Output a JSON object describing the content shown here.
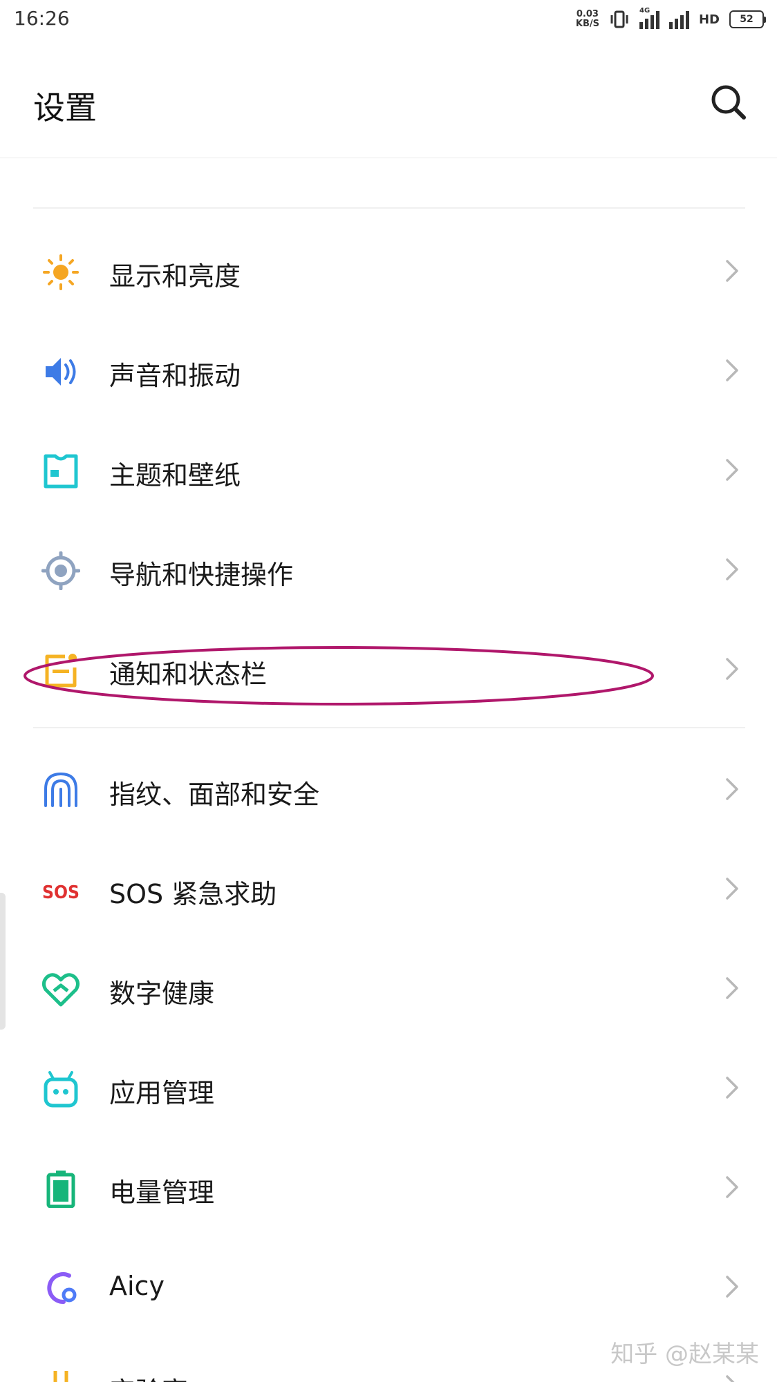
{
  "status_bar": {
    "time": "16:26",
    "net_speed_value": "0.03",
    "net_speed_unit": "KB/S",
    "network_tag": "4G",
    "hd_label": "HD",
    "battery_level": "52"
  },
  "header": {
    "title": "设置"
  },
  "settings_items": [
    {
      "label": "显示和亮度",
      "icon": "sun-icon",
      "color": "#F5A623"
    },
    {
      "label": "声音和振动",
      "icon": "speaker-icon",
      "color": "#3D7BE6"
    },
    {
      "label": "主题和壁纸",
      "icon": "shirt-icon",
      "color": "#1FC6D0"
    },
    {
      "label": "导航和快捷操作",
      "icon": "target-icon",
      "color": "#8FA3C0"
    },
    {
      "label": "通知和状态栏",
      "icon": "notification-icon",
      "color": "#F5B324"
    },
    {
      "label": "指纹、面部和安全",
      "icon": "fingerprint-icon",
      "color": "#3D7BE6"
    },
    {
      "label": "SOS 紧急求助",
      "icon": "sos-icon",
      "color": "#E03131"
    },
    {
      "label": "数字健康",
      "icon": "heart-icon",
      "color": "#1DBF8A"
    },
    {
      "label": "应用管理",
      "icon": "android-icon",
      "color": "#1FC6D0"
    },
    {
      "label": "电量管理",
      "icon": "battery-icon",
      "color": "#17B57A"
    },
    {
      "label": "Aicy",
      "icon": "aicy-icon",
      "color": "#8B5CF6"
    },
    {
      "label": "实验室",
      "icon": "flask-icon",
      "color": "#F5B324"
    }
  ],
  "annotation_color": "#B0176B",
  "watermark": "知乎 @赵某某"
}
